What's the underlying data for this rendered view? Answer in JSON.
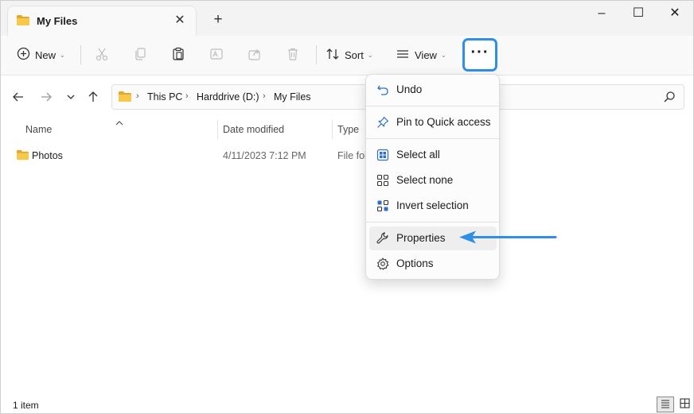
{
  "window": {
    "tab_title": "My Files",
    "controls": {
      "minimize": "–",
      "maximize": "☐",
      "close": "✕"
    }
  },
  "toolbar": {
    "new_label": "New",
    "sort_label": "Sort",
    "view_label": "View",
    "more_label": "···",
    "highlight_color": "#2f8ee8"
  },
  "address": {
    "crumbs": [
      "This PC",
      "Harddrive (D:)",
      "My Files"
    ]
  },
  "columns": {
    "name": "Name",
    "date_modified": "Date modified",
    "type": "Type"
  },
  "files": [
    {
      "name": "Photos",
      "date_modified": "4/11/2023 7:12 PM",
      "type": "File folder"
    }
  ],
  "menu": {
    "items": [
      {
        "label": "Undo",
        "icon": "undo-icon"
      },
      {
        "label": "Pin to Quick access",
        "icon": "pin-icon"
      },
      {
        "label": "Select all",
        "icon": "select-all-icon"
      },
      {
        "label": "Select none",
        "icon": "select-none-icon"
      },
      {
        "label": "Invert selection",
        "icon": "invert-selection-icon"
      },
      {
        "label": "Properties",
        "icon": "wrench-icon"
      },
      {
        "label": "Options",
        "icon": "gear-icon"
      }
    ],
    "highlighted": "Properties"
  },
  "status": {
    "item_count": "1 item"
  },
  "colors": {
    "accent": "#2f8ee8",
    "folder": "#f7c948",
    "folder_dark": "#e3a82b"
  }
}
